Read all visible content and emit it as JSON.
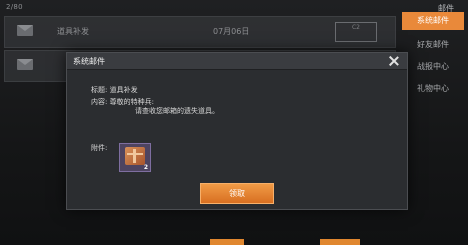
{
  "mail_list": {
    "count": "2/80",
    "rows": [
      {
        "title": "道具补发",
        "date": "07月06日",
        "badge": "C2"
      },
      {
        "title": "",
        "date": "",
        "badge": ""
      }
    ]
  },
  "sidebar": {
    "header": "邮件",
    "tabs": [
      {
        "label": "系统邮件",
        "active": true
      },
      {
        "label": "好友邮件",
        "active": false
      },
      {
        "label": "战报中心",
        "active": false
      },
      {
        "label": "礼物中心",
        "active": false
      }
    ]
  },
  "modal": {
    "title": "系统邮件",
    "subject_label": "标题:",
    "subject_value": "道具补发",
    "content_label": "内容:",
    "greeting": "尊敬的特种兵:",
    "body": "请查收您邮箱的遗失道具。",
    "attachment_label": "附件:",
    "attachment_qty": "2",
    "claim_label": "领取"
  },
  "colors": {
    "accent": "#e9893a",
    "modal_bg": "#2b2d30",
    "item_slot": "#4e4460"
  }
}
